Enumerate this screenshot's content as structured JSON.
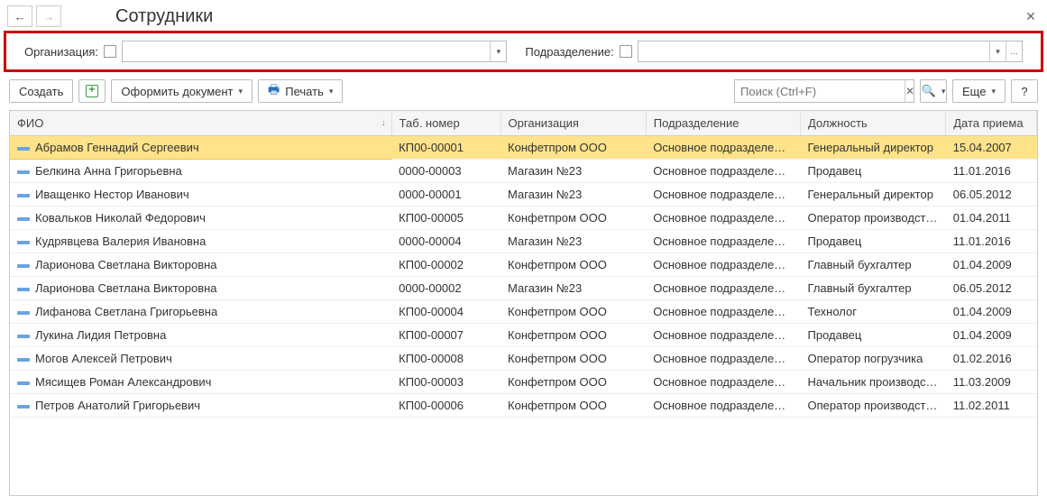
{
  "header": {
    "title": "Сотрудники"
  },
  "filters": {
    "org_label": "Организация:",
    "dept_label": "Подразделение:"
  },
  "toolbar": {
    "create": "Создать",
    "doc": "Оформить документ",
    "print": "Печать",
    "more": "Еще",
    "help": "?",
    "search_placeholder": "Поиск (Ctrl+F)"
  },
  "columns": {
    "fio": "ФИО",
    "tab": "Таб. номер",
    "org": "Организация",
    "dept": "Подразделение",
    "pos": "Должность",
    "date": "Дата приема"
  },
  "rows": [
    {
      "fio": "Абрамов Геннадий Сергеевич",
      "tab": "КП00-00001",
      "org": "Конфетпром ООО",
      "dept": "Основное подразделе…",
      "pos": "Генеральный директор",
      "date": "15.04.2007",
      "selected": true
    },
    {
      "fio": "Белкина Анна Григорьевна",
      "tab": "0000-00003",
      "org": "Магазин №23",
      "dept": "Основное подразделе…",
      "pos": "Продавец",
      "date": "11.01.2016"
    },
    {
      "fio": "Иващенко Нестор Иванович",
      "tab": "0000-00001",
      "org": "Магазин №23",
      "dept": "Основное подразделе…",
      "pos": "Генеральный директор",
      "date": "06.05.2012"
    },
    {
      "fio": "Ковальков Николай Федорович",
      "tab": "КП00-00005",
      "org": "Конфетпром ООО",
      "dept": "Основное подразделе…",
      "pos": "Оператор производст…",
      "date": "01.04.2011"
    },
    {
      "fio": "Кудрявцева Валерия Ивановна",
      "tab": "0000-00004",
      "org": "Магазин №23",
      "dept": "Основное подразделе…",
      "pos": "Продавец",
      "date": "11.01.2016"
    },
    {
      "fio": "Ларионова Светлана Викторовна",
      "tab": "КП00-00002",
      "org": "Конфетпром ООО",
      "dept": "Основное подразделе…",
      "pos": "Главный бухгалтер",
      "date": "01.04.2009"
    },
    {
      "fio": "Ларионова Светлана Викторовна",
      "tab": "0000-00002",
      "org": "Магазин №23",
      "dept": "Основное подразделе…",
      "pos": "Главный бухгалтер",
      "date": "06.05.2012"
    },
    {
      "fio": "Лифанова Светлана Григорьевна",
      "tab": "КП00-00004",
      "org": "Конфетпром ООО",
      "dept": "Основное подразделе…",
      "pos": "Технолог",
      "date": "01.04.2009"
    },
    {
      "fio": "Лукина Лидия Петровна",
      "tab": "КП00-00007",
      "org": "Конфетпром ООО",
      "dept": "Основное подразделе…",
      "pos": "Продавец",
      "date": "01.04.2009"
    },
    {
      "fio": "Могов Алексей Петрович",
      "tab": "КП00-00008",
      "org": "Конфетпром ООО",
      "dept": "Основное подразделе…",
      "pos": "Оператор погрузчика",
      "date": "01.02.2016"
    },
    {
      "fio": "Мясищев Роман Александрович",
      "tab": "КП00-00003",
      "org": "Конфетпром ООО",
      "dept": "Основное подразделе…",
      "pos": "Начальник производс…",
      "date": "11.03.2009"
    },
    {
      "fio": "Петров Анатолий Григорьевич",
      "tab": "КП00-00006",
      "org": "Конфетпром ООО",
      "dept": "Основное подразделе…",
      "pos": "Оператор производст…",
      "date": "11.02.2011"
    }
  ]
}
